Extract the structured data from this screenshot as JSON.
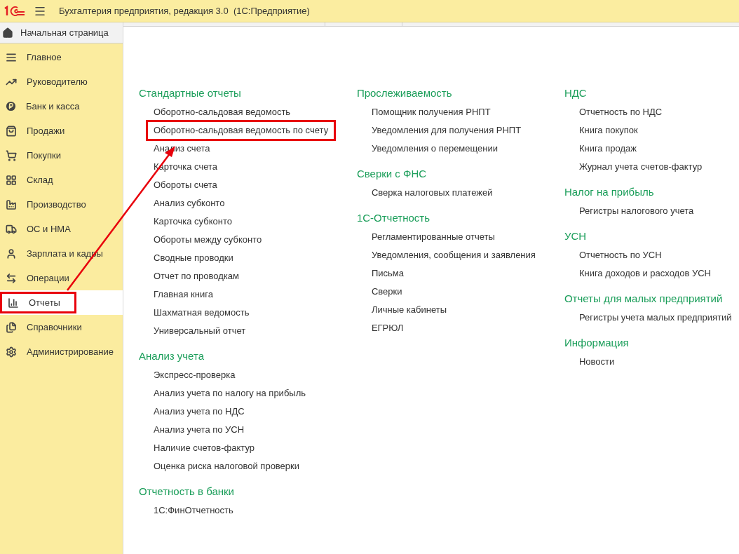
{
  "window": {
    "title": "Бухгалтерия предприятия, редакция 3.0  (1С:Предприятие)"
  },
  "home": {
    "label": "Начальная страница"
  },
  "sidebar": {
    "items": [
      {
        "label": "Главное",
        "selected": false,
        "highlighted": false
      },
      {
        "label": "Руководителю",
        "selected": false,
        "highlighted": false
      },
      {
        "label": "Банк и касса",
        "selected": false,
        "highlighted": false
      },
      {
        "label": "Продажи",
        "selected": false,
        "highlighted": false
      },
      {
        "label": "Покупки",
        "selected": false,
        "highlighted": false
      },
      {
        "label": "Склад",
        "selected": false,
        "highlighted": false
      },
      {
        "label": "Производство",
        "selected": false,
        "highlighted": false
      },
      {
        "label": "ОС и НМА",
        "selected": false,
        "highlighted": false
      },
      {
        "label": "Зарплата и кадры",
        "selected": false,
        "highlighted": false
      },
      {
        "label": "Операции",
        "selected": false,
        "highlighted": false
      },
      {
        "label": "Отчеты",
        "selected": true,
        "highlighted": true
      },
      {
        "label": "Справочники",
        "selected": false,
        "highlighted": false
      },
      {
        "label": "Администрирование",
        "selected": false,
        "highlighted": false
      }
    ]
  },
  "columns": [
    [
      {
        "title": "Стандартные отчеты",
        "links": [
          {
            "label": "Оборотно-сальдовая ведомость",
            "highlighted": false
          },
          {
            "label": "Оборотно-сальдовая ведомость по счету",
            "highlighted": true
          },
          {
            "label": "Анализ счета",
            "highlighted": false
          },
          {
            "label": "Карточка счета",
            "highlighted": false
          },
          {
            "label": "Обороты счета",
            "highlighted": false
          },
          {
            "label": "Анализ субконто",
            "highlighted": false
          },
          {
            "label": "Карточка субконто",
            "highlighted": false
          },
          {
            "label": "Обороты между субконто",
            "highlighted": false
          },
          {
            "label": "Сводные проводки",
            "highlighted": false
          },
          {
            "label": "Отчет по проводкам",
            "highlighted": false
          },
          {
            "label": "Главная книга",
            "highlighted": false
          },
          {
            "label": "Шахматная ведомость",
            "highlighted": false
          },
          {
            "label": "Универсальный отчет",
            "highlighted": false
          }
        ]
      },
      {
        "title": "Анализ учета",
        "links": [
          {
            "label": "Экспресс-проверка",
            "highlighted": false
          },
          {
            "label": "Анализ учета по налогу на прибыль",
            "highlighted": false
          },
          {
            "label": "Анализ учета по НДС",
            "highlighted": false
          },
          {
            "label": "Анализ учета по УСН",
            "highlighted": false
          },
          {
            "label": "Наличие счетов-фактур",
            "highlighted": false
          },
          {
            "label": "Оценка риска налоговой проверки",
            "highlighted": false
          }
        ]
      },
      {
        "title": "Отчетность в банки",
        "links": [
          {
            "label": "1С:ФинОтчетность",
            "highlighted": false
          }
        ]
      }
    ],
    [
      {
        "title": "Прослеживаемость",
        "links": [
          {
            "label": "Помощник получения РНПТ",
            "highlighted": false
          },
          {
            "label": "Уведомления для получения РНПТ",
            "highlighted": false
          },
          {
            "label": "Уведомления о перемещении",
            "highlighted": false
          }
        ]
      },
      {
        "title": "Сверки с ФНС",
        "links": [
          {
            "label": "Сверка налоговых платежей",
            "highlighted": false
          }
        ]
      },
      {
        "title": "1С-Отчетность",
        "links": [
          {
            "label": "Регламентированные отчеты",
            "highlighted": false
          },
          {
            "label": "Уведомления, сообщения и заявления",
            "highlighted": false
          },
          {
            "label": "Письма",
            "highlighted": false
          },
          {
            "label": "Сверки",
            "highlighted": false
          },
          {
            "label": "Личные кабинеты",
            "highlighted": false
          },
          {
            "label": "ЕГРЮЛ",
            "highlighted": false
          }
        ]
      }
    ],
    [
      {
        "title": "НДС",
        "links": [
          {
            "label": "Отчетность по НДС",
            "highlighted": false
          },
          {
            "label": "Книга покупок",
            "highlighted": false
          },
          {
            "label": "Книга продаж",
            "highlighted": false
          },
          {
            "label": "Журнал учета счетов-фактур",
            "highlighted": false
          }
        ]
      },
      {
        "title": "Налог на прибыль",
        "links": [
          {
            "label": "Регистры налогового учета",
            "highlighted": false
          }
        ]
      },
      {
        "title": "УСН",
        "links": [
          {
            "label": "Отчетность по УСН",
            "highlighted": false
          },
          {
            "label": "Книга доходов и расходов УСН",
            "highlighted": false
          }
        ]
      },
      {
        "title": "Отчеты для малых предприятий",
        "links": [
          {
            "label": "Регистры учета малых предприятий",
            "highlighted": false
          }
        ]
      },
      {
        "title": "Информация",
        "links": [
          {
            "label": "Новости",
            "highlighted": false
          }
        ]
      }
    ]
  ]
}
